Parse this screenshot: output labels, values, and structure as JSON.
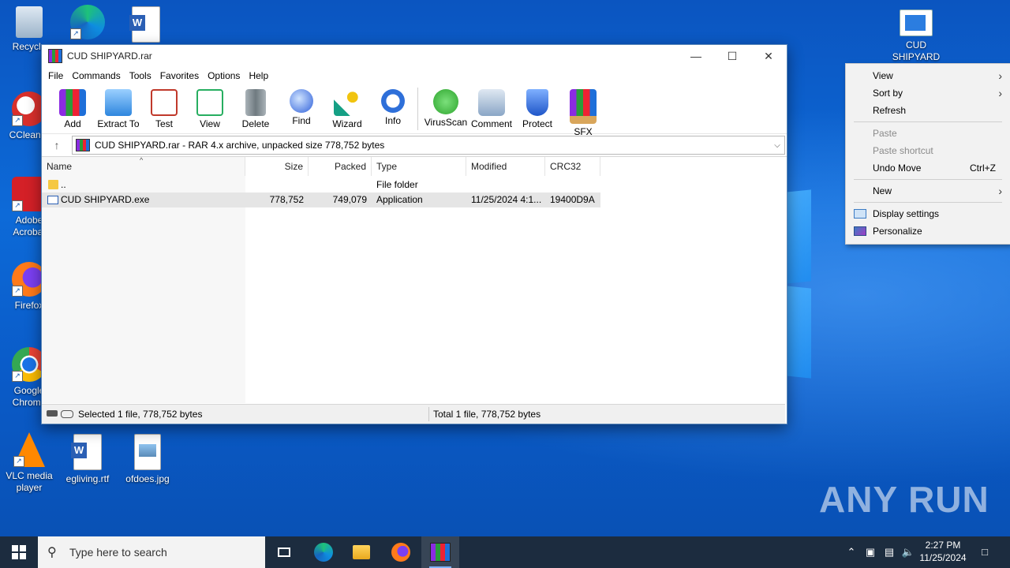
{
  "desktop": {
    "icons": [
      {
        "label": "Recycle",
        "icon": "recycle-bin-icon"
      },
      {
        "label": "",
        "icon": "edge-icon"
      },
      {
        "label": "",
        "icon": "word-doc-icon"
      },
      {
        "label": "CCleaner",
        "icon": "ccleaner-icon"
      },
      {
        "label": "Adobe Acrobat",
        "icon": "acrobat-icon"
      },
      {
        "label": "Firefox",
        "icon": "firefox-icon"
      },
      {
        "label": "Google Chrome",
        "icon": "chrome-icon"
      },
      {
        "label": "VLC media player",
        "icon": "vlc-icon"
      },
      {
        "label": "egliving.rtf",
        "icon": "word-doc-icon"
      },
      {
        "label": "ofdoes.jpg",
        "icon": "image-file-icon"
      },
      {
        "label": "CUD SHIPYARD",
        "icon": "exe-icon"
      }
    ],
    "watermark": "ANY RUN"
  },
  "winrar": {
    "title": "CUD SHIPYARD.rar",
    "menu": [
      "File",
      "Commands",
      "Tools",
      "Favorites",
      "Options",
      "Help"
    ],
    "toolbar": [
      {
        "label": "Add",
        "icon": "add-icon",
        "color": "#c0392b"
      },
      {
        "label": "Extract To",
        "icon": "extract-to-icon",
        "color": "#2e86de"
      },
      {
        "label": "Test",
        "icon": "test-icon",
        "color": "#e74c3c"
      },
      {
        "label": "View",
        "icon": "view-icon",
        "color": "#27ae60"
      },
      {
        "label": "Delete",
        "icon": "delete-icon",
        "color": "#7f8c8d"
      },
      {
        "label": "Find",
        "icon": "find-icon",
        "color": "#2e5fd9"
      },
      {
        "label": "Wizard",
        "icon": "wizard-icon",
        "color": "#16a085"
      },
      {
        "label": "Info",
        "icon": "info-icon",
        "color": "#2e6fd9"
      }
    ],
    "toolbar2": [
      {
        "label": "VirusScan",
        "icon": "virusscan-icon",
        "color": "#2ea52e"
      },
      {
        "label": "Comment",
        "icon": "comment-icon",
        "color": "#6b8fb8"
      },
      {
        "label": "Protect",
        "icon": "protect-icon",
        "color": "#2e6fd9"
      },
      {
        "label": "SFX",
        "icon": "sfx-icon",
        "color": "#c0392b"
      }
    ],
    "address": "CUD SHIPYARD.rar - RAR 4.x archive, unpacked size 778,752 bytes",
    "columns": {
      "name": "Name",
      "size": "Size",
      "packed": "Packed",
      "type": "Type",
      "modified": "Modified",
      "crc": "CRC32"
    },
    "rows": [
      {
        "name": "..",
        "size": "",
        "packed": "",
        "type": "File folder",
        "modified": "",
        "crc": ""
      },
      {
        "name": "CUD SHIPYARD.exe",
        "size": "778,752",
        "packed": "749,079",
        "type": "Application",
        "modified": "11/25/2024 4:1...",
        "crc": "19400D9A"
      }
    ],
    "status_left": "Selected 1 file, 778,752 bytes",
    "status_right": "Total 1 file, 778,752 bytes"
  },
  "context_menu": {
    "view": "View",
    "sort_by": "Sort by",
    "refresh": "Refresh",
    "paste": "Paste",
    "paste_shortcut": "Paste shortcut",
    "undo_move": "Undo Move",
    "undo_shortcut": "Ctrl+Z",
    "new": "New",
    "display_settings": "Display settings",
    "personalize": "Personalize"
  },
  "taskbar": {
    "search_placeholder": "Type here to search",
    "time": "2:27 PM",
    "date": "11/25/2024"
  }
}
